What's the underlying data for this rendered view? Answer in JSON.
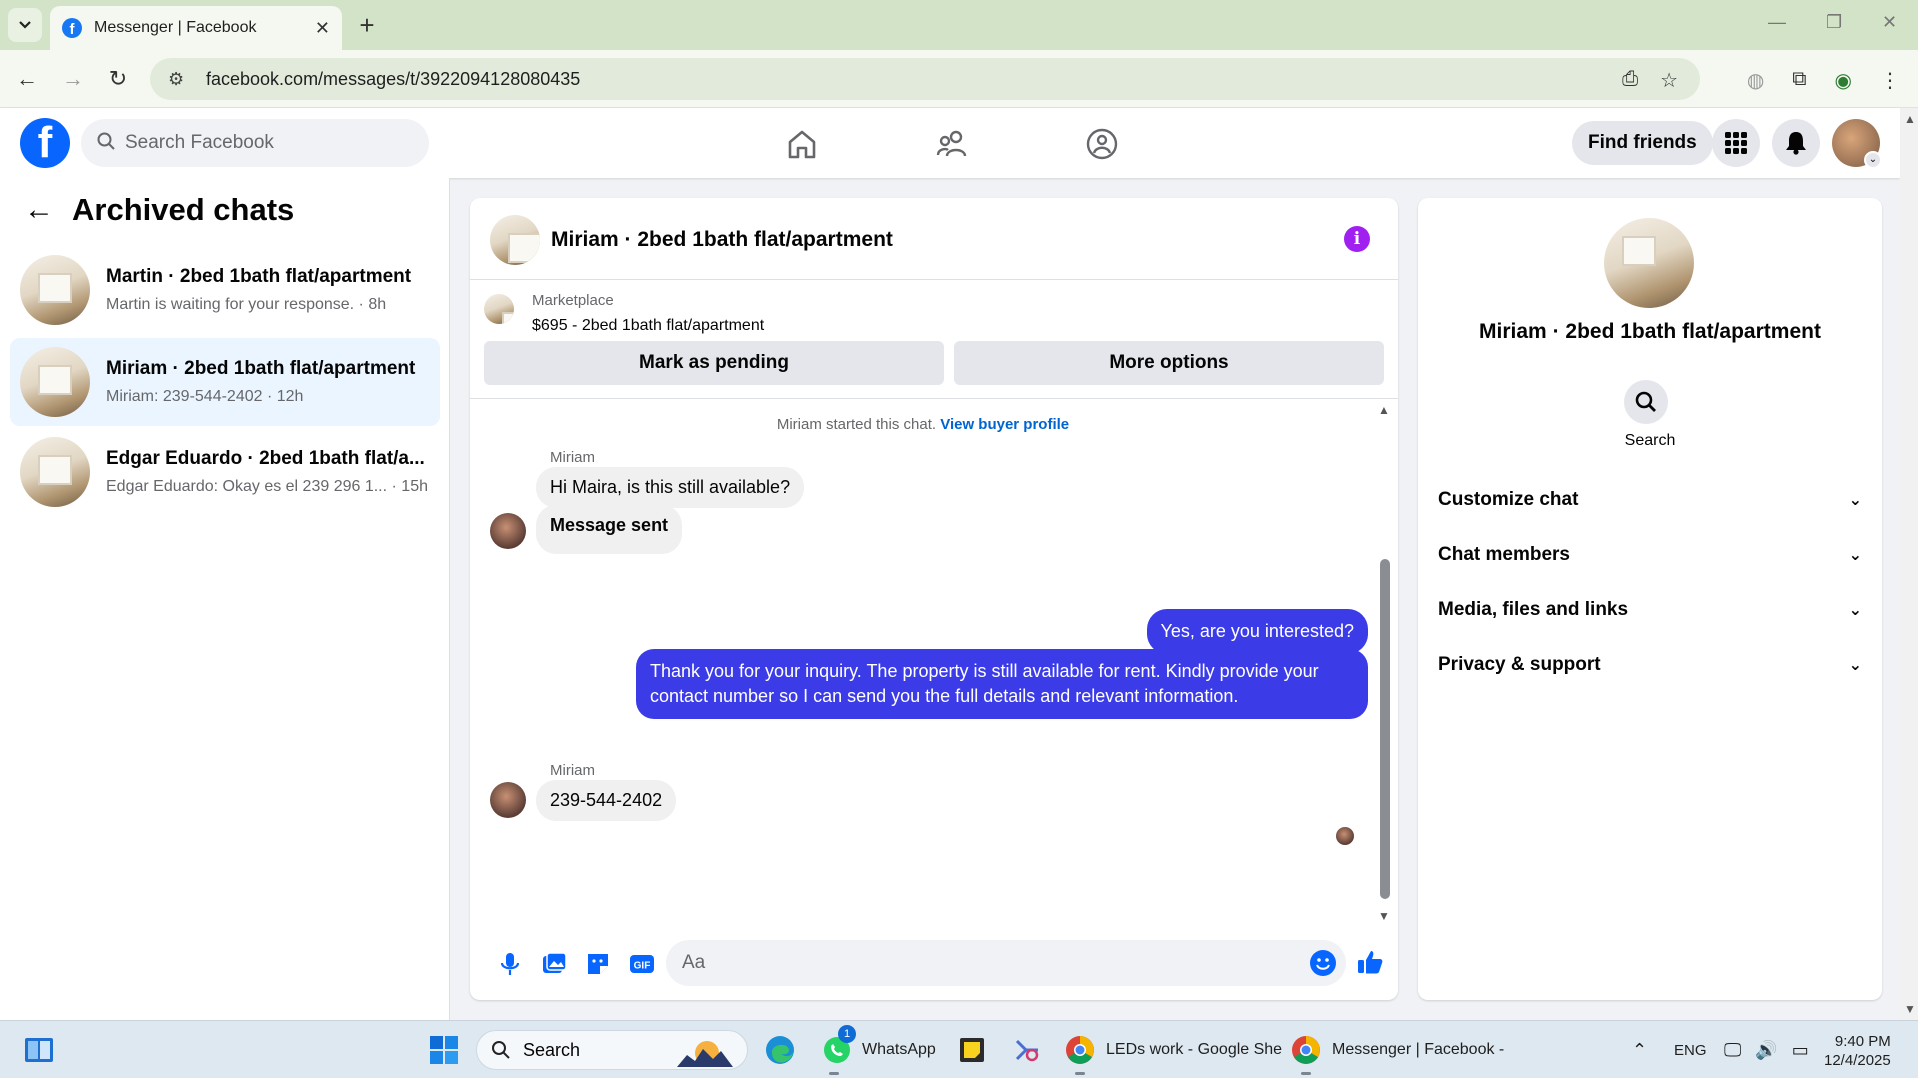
{
  "browser": {
    "tab_title": "Messenger | Facebook",
    "url": "facebook.com/messages/t/3922094128080435"
  },
  "fb_header": {
    "search_placeholder": "Search Facebook",
    "find_friends": "Find friends"
  },
  "sidebar": {
    "title": "Archived chats",
    "chats": [
      {
        "name": "Martin · 2bed 1bath flat/apartment",
        "preview": "Martin is waiting for your response. · 8h",
        "active": false
      },
      {
        "name": "Miriam · 2bed 1bath flat/apartment",
        "preview": "Miriam: 239-544-2402 · 12h",
        "active": true
      },
      {
        "name": "Edgar Eduardo · 2bed 1bath flat/a...",
        "preview": "Edgar Eduardo: Okay es el 239 296 1... · 15h",
        "active": false
      }
    ]
  },
  "chat": {
    "title": "Miriam · 2bed 1bath flat/apartment",
    "marketplace_label": "Marketplace",
    "listing": "$695 - 2bed 1bath flat/apartment",
    "mark_pending": "Mark as pending",
    "more_options": "More options",
    "started_text": "Miriam started this chat.",
    "view_buyer_profile": "View buyer profile",
    "messages": [
      {
        "sender": "Miriam",
        "text": "Hi Maira, is this still available?"
      },
      {
        "text": "Message sent"
      },
      {
        "text": "Yes, are you interested?"
      },
      {
        "text": "Thank you for your inquiry. The property is still available for rent. Kindly provide your contact number so I can send you the full details and relevant information."
      },
      {
        "sender": "Miriam",
        "text": "239-544-2402"
      }
    ],
    "composer_placeholder": "Aa"
  },
  "info_panel": {
    "name": "Miriam · 2bed 1bath flat/apartment",
    "search_label": "Search",
    "sections": [
      "Customize chat",
      "Chat members",
      "Media, files and links",
      "Privacy & support"
    ]
  },
  "taskbar": {
    "search": "Search",
    "whatsapp": "WhatsApp",
    "whatsapp_badge": "1",
    "sheets": "LEDs work - Google She",
    "messenger": "Messenger | Facebook -",
    "lang": "ENG",
    "time": "9:40 PM",
    "date": "12/4/2025"
  },
  "colors": {
    "fb_blue": "#0866ff",
    "outgoing_bubble": "#3b3be8",
    "info_purple": "#a020f0",
    "active_chat": "#ebf5ff"
  }
}
